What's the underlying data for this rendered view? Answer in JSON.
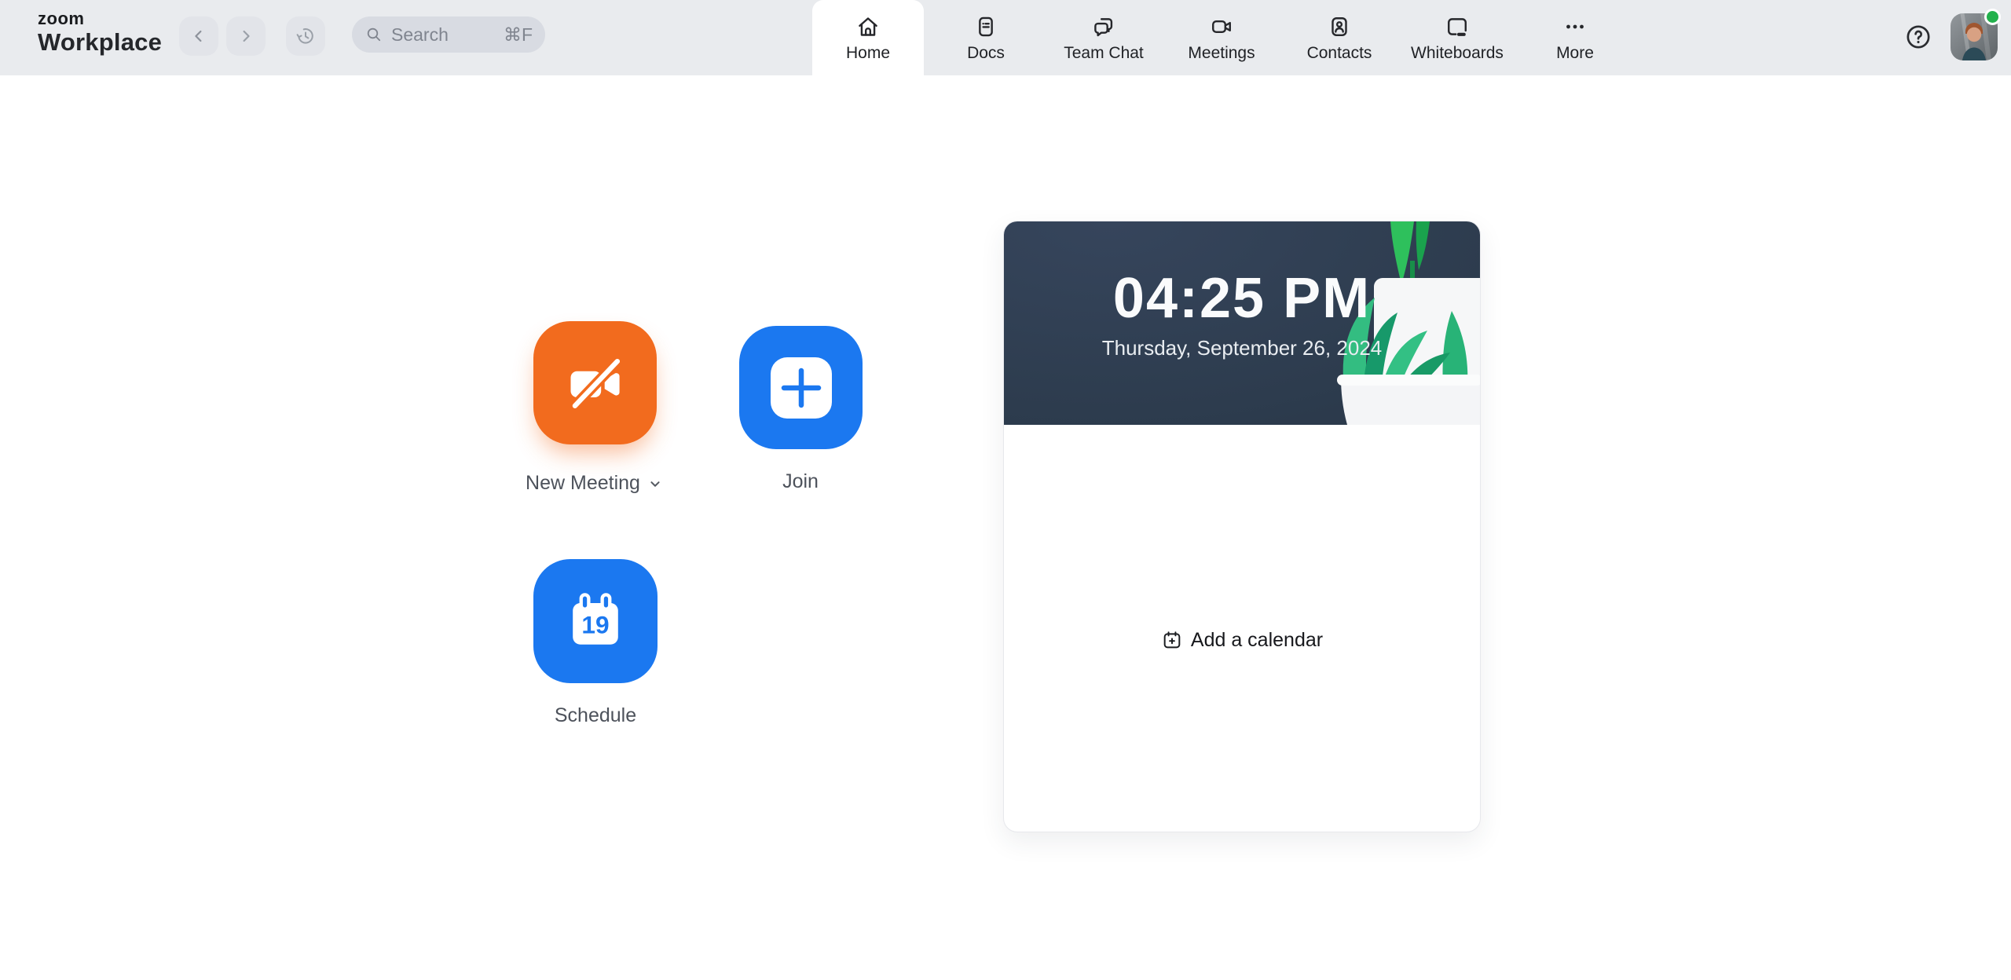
{
  "header": {
    "logo": {
      "brand": "zoom",
      "product": "Workplace"
    },
    "search": {
      "placeholder": "Search",
      "shortcut": "⌘F"
    },
    "tabs": [
      {
        "label": "Home",
        "active": true
      },
      {
        "label": "Docs",
        "active": false
      },
      {
        "label": "Team Chat",
        "active": false
      },
      {
        "label": "Meetings",
        "active": false
      },
      {
        "label": "Contacts",
        "active": false
      },
      {
        "label": "Whiteboards",
        "active": false
      },
      {
        "label": "More",
        "active": false
      }
    ],
    "user_status": "online"
  },
  "quick_actions": {
    "new_meeting": {
      "label": "New Meeting",
      "has_dropdown": true
    },
    "join": {
      "label": "Join"
    },
    "schedule": {
      "label": "Schedule",
      "calendar_day": "19"
    }
  },
  "calendar_card": {
    "time": "04:25 PM",
    "date": "Thursday, September 26, 2024",
    "add_calendar_label": "Add a calendar"
  },
  "colors": {
    "header_bg": "#e9ebee",
    "accent_orange": "#f26b1e",
    "accent_blue": "#1b78f0",
    "hero_bg": "#2d3c4e",
    "status_green": "#22b14c"
  }
}
